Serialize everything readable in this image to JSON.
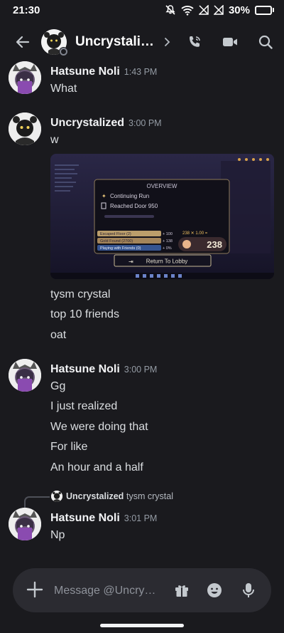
{
  "status_bar": {
    "time": "21:30",
    "battery": "30%",
    "battery_level": 0.3
  },
  "header": {
    "title": "Uncrystalized",
    "back_icon": "arrow-left-icon",
    "chevron_icon": "chevron-right-icon",
    "actions": [
      "phone-call-icon",
      "video-camera-icon",
      "search-icon"
    ]
  },
  "messages": [
    {
      "author": "Hatsune Noli",
      "time": "1:43 PM",
      "lines": [
        "What"
      ]
    },
    {
      "author": "Uncrystalized",
      "time": "3:00 PM",
      "lines": [
        "w",
        "tysm crystal",
        "top 10 friends",
        "oat"
      ],
      "attachment": {
        "overview_title": "OVERVIEW",
        "row1": "Continuing Run",
        "row2": "Reached Door 950",
        "stat1_label": "Escaped Floor (2)",
        "stat1_value": "+ 100",
        "stat2_label": "Gold Found (2700)",
        "stat2_value": "+ 138",
        "stat3_label": "Playing with Friends (0)",
        "stat3_value": "+ 0%",
        "multiplier": "238 ✕ 1.00 =",
        "total": "238",
        "button": "Return To Lobby"
      }
    },
    {
      "author": "Hatsune Noli",
      "time": "3:00 PM",
      "lines": [
        "Gg",
        "I just realized",
        "We were doing that",
        "For like",
        "An hour and a half"
      ]
    },
    {
      "author": "Hatsune Noli",
      "time": "3:01 PM",
      "lines": [
        "Np"
      ],
      "reply": {
        "author": "Uncrystalized",
        "text": "tysm crystal"
      }
    }
  ],
  "composer": {
    "placeholder": "Message @Uncrystalized",
    "icons": [
      "plus-icon",
      "gift-icon",
      "emoji-icon",
      "microphone-icon"
    ]
  },
  "colors": {
    "background": "#1a1a1e",
    "composer_bg": "#2b2b31",
    "text_primary": "#f2f3f5",
    "text_muted": "#949ba4",
    "battery_fill": "#f6c744"
  }
}
